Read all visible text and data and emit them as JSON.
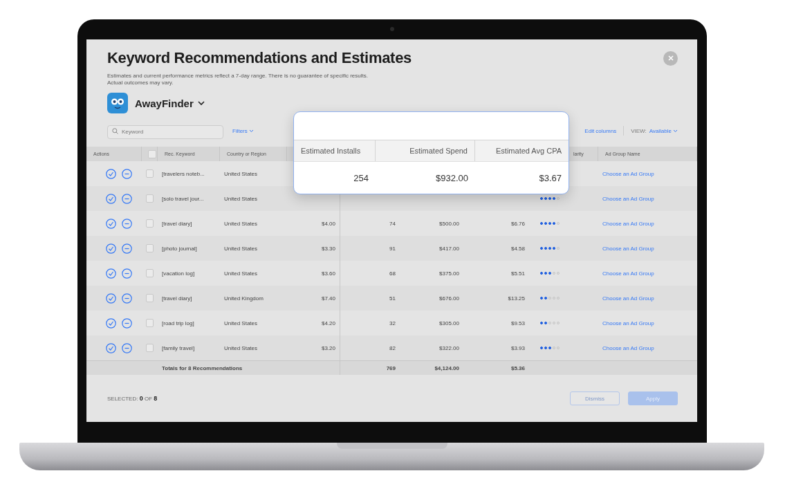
{
  "dialog": {
    "title": "Keyword Recommendations and Estimates",
    "subtitle": "Estimates and current performance metrics reflect a 7-day range. There is no guarantee of specific results. Actual outcomes may vary.",
    "app": {
      "name": "AwayFinder"
    },
    "search": {
      "placeholder": "Keyword"
    },
    "filters": "Filters",
    "toolbar": {
      "edit_columns": "Edit columns",
      "view_label": "VIEW:",
      "view_value": "Available"
    },
    "table": {
      "columns": [
        "Actions",
        "Rec. Keyword",
        "Country or Region",
        "larity",
        "Ad Group Name"
      ],
      "select_all_checked": false,
      "rows": [
        {
          "keyword": "[travelers noteb...",
          "country": "United States",
          "ad_group": "Choose an Ad Group",
          "checked": false
        },
        {
          "keyword": "[solo travel jour...",
          "country": "United States",
          "stars": 4,
          "ad_group": "Choose an Ad Group",
          "checked": false
        },
        {
          "keyword": "[travel diary]",
          "country": "United States",
          "bid": "$4.00",
          "installs": "74",
          "spend": "$500.00",
          "cpa": "$6.76",
          "stars": 4,
          "ad_group": "Choose an Ad Group",
          "checked": false
        },
        {
          "keyword": "[photo journal]",
          "country": "United States",
          "bid": "$3.30",
          "installs": "91",
          "spend": "$417.00",
          "cpa": "$4.58",
          "stars": 4,
          "ad_group": "Choose an Ad Group",
          "checked": false
        },
        {
          "keyword": "[vacation log]",
          "country": "United States",
          "bid": "$3.60",
          "installs": "68",
          "spend": "$375.00",
          "cpa": "$5.51",
          "stars": 3,
          "ad_group": "Choose an Ad Group",
          "checked": false
        },
        {
          "keyword": "[travel diary]",
          "country": "United Kingdom",
          "bid": "$7.40",
          "installs": "51",
          "spend": "$676.00",
          "cpa": "$13.25",
          "stars": 2,
          "ad_group": "Choose an Ad Group",
          "checked": false
        },
        {
          "keyword": "[road trip log]",
          "country": "United States",
          "bid": "$4.20",
          "installs": "32",
          "spend": "$305.00",
          "cpa": "$9.53",
          "stars": 2,
          "ad_group": "Choose an Ad Group",
          "checked": false
        },
        {
          "keyword": "[family travel]",
          "country": "United States",
          "bid": "$3.20",
          "installs": "82",
          "spend": "$322.00",
          "cpa": "$3.93",
          "stars": 3,
          "ad_group": "Choose an Ad Group",
          "checked": false
        }
      ],
      "totals": {
        "label": "Totals for 8 Recommendations",
        "installs": "769",
        "spend": "$4,124.00",
        "cpa": "$5.36"
      }
    },
    "footer": {
      "selected": "SELECTED: **0** OF **8**",
      "buttons": [
        {
          "label": "Dismiss",
          "kind": "secondary",
          "disabled": true
        },
        {
          "label": "Apply",
          "kind": "primary",
          "disabled": true
        }
      ]
    },
    "popup": {
      "columns": [
        "Estimated Installs",
        "Estimated Spend",
        "Estimated Avg CPA"
      ],
      "values": [
        "254",
        "$932.00",
        "$3.67"
      ]
    }
  }
}
